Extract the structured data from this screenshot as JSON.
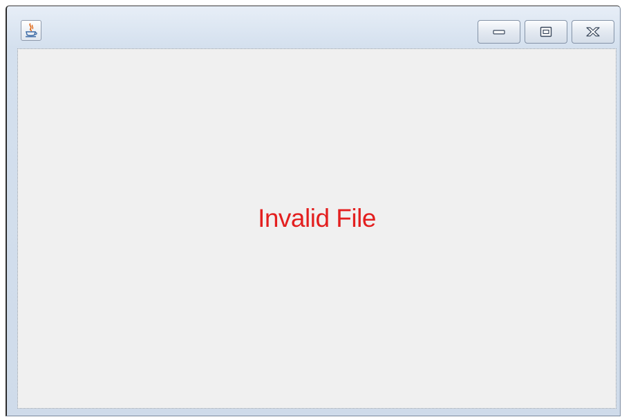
{
  "window": {
    "icon": "java-coffee-cup-icon",
    "controls": {
      "minimize_icon": "minimize-icon",
      "maximize_icon": "maximize-icon",
      "close_icon": "close-icon"
    }
  },
  "content": {
    "message": "Invalid File",
    "message_color": "#e31f1f",
    "background_color": "#f0f0f0"
  }
}
